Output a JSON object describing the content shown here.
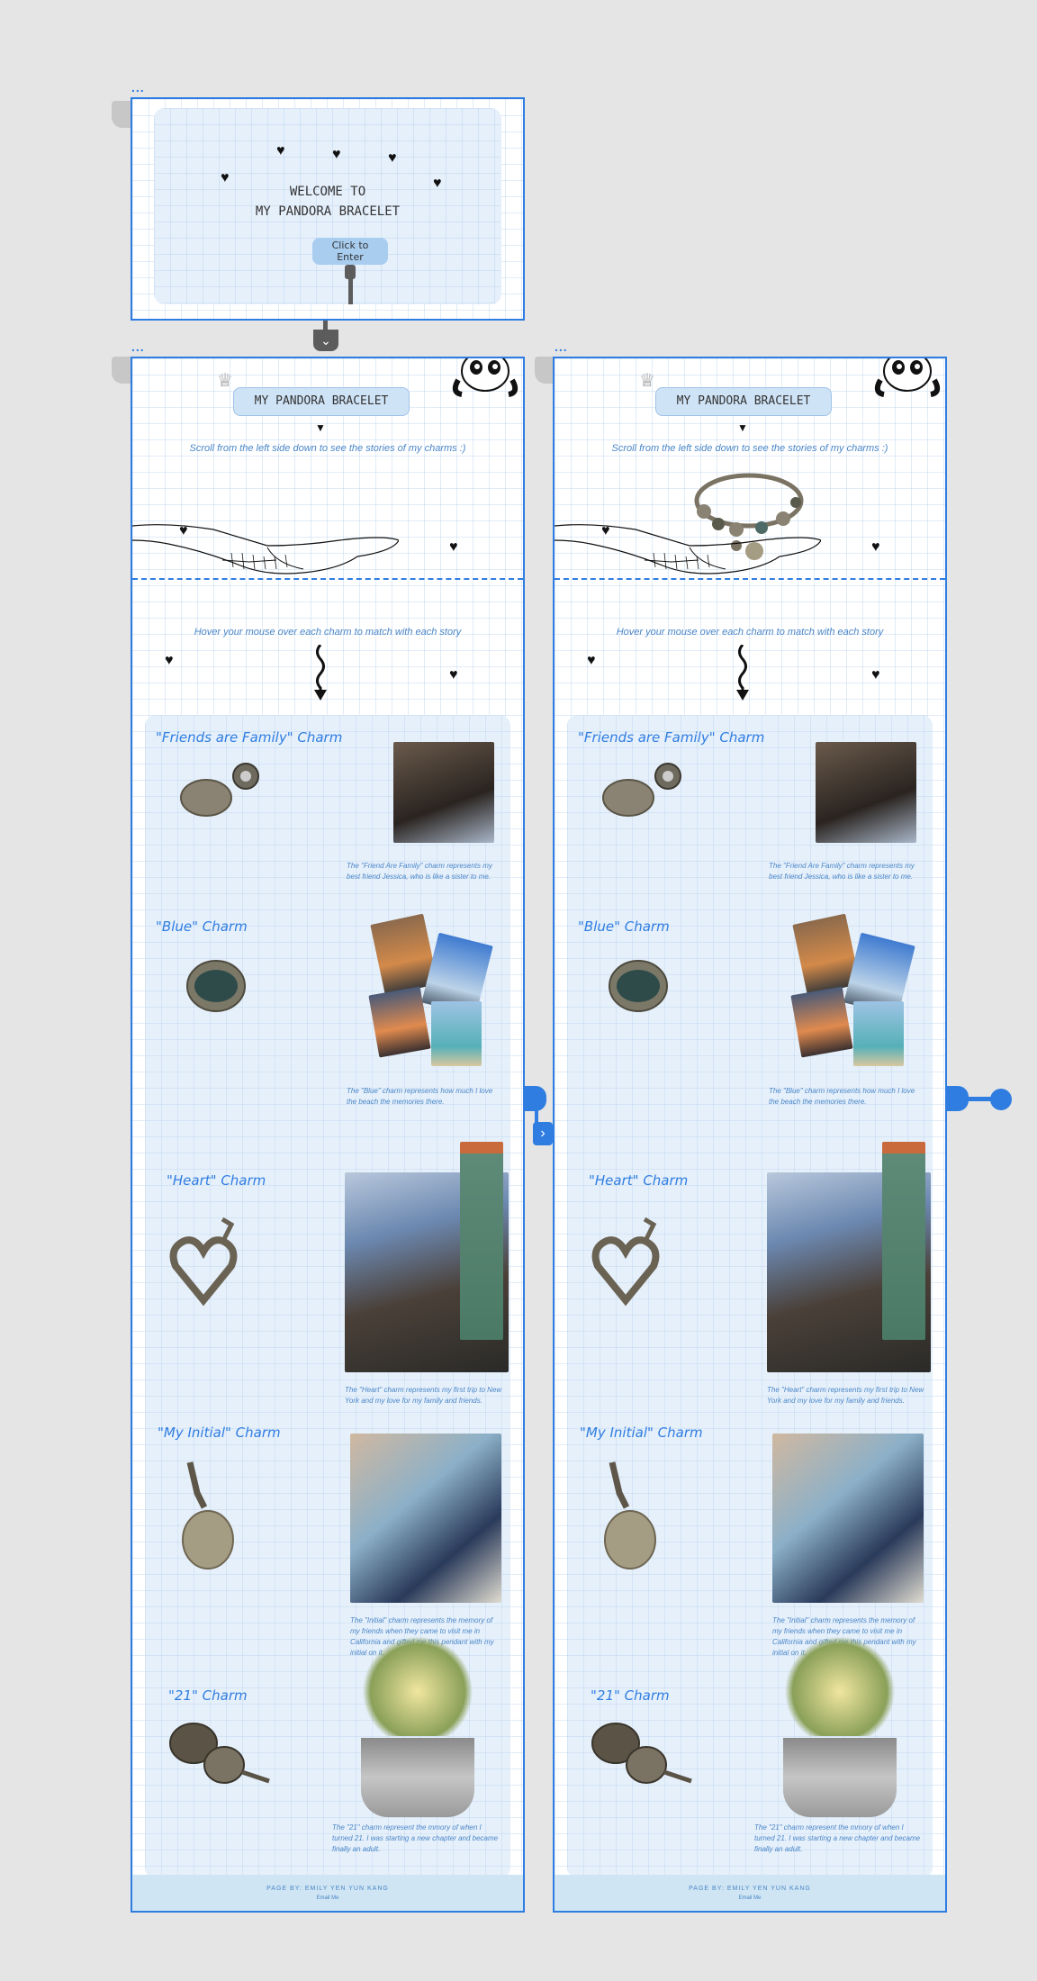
{
  "welcome": {
    "title_line1": "WELCOME TO",
    "title_line2": "MY PANDORA BRACELET",
    "enter_button": "Click to Enter"
  },
  "page": {
    "title": "MY PANDORA BRACELET",
    "scroll_hint": "Scroll from the left side down to see the stories of my charms :)",
    "hover_hint": "Hover your mouse over each charm to match with each story"
  },
  "charms": [
    {
      "title": "\"Friends are Family\" Charm",
      "story": "The \"Friend Are Family\" charm represents my best friend Jessica, who is like a sister to me."
    },
    {
      "title": "\"Blue\" Charm",
      "story": "The \"Blue\" charm represents how much I love the beach the memories there."
    },
    {
      "title": "\"Heart\" Charm",
      "story": "The \"Heart\" charm represents my first trip to New York and my love for my family and friends."
    },
    {
      "title": "\"My Initial\" Charm",
      "story": "The \"Initial\" charm represents the memory of my friends when they came to visit me in California and gifted me this pendant with my initial on it."
    },
    {
      "title": "\"21\" Charm",
      "story": "The \"21\" charm represent the mmory of when I turned 21. I was starting a new chapter and became finally an adult."
    }
  ],
  "footer": {
    "credit": "PAGE BY: EMILY YEN YUN KANG",
    "email": "Email Me"
  },
  "colors": {
    "accent": "#2f7de1",
    "panel": "#e6f0fb",
    "button": "#a8cdef"
  }
}
